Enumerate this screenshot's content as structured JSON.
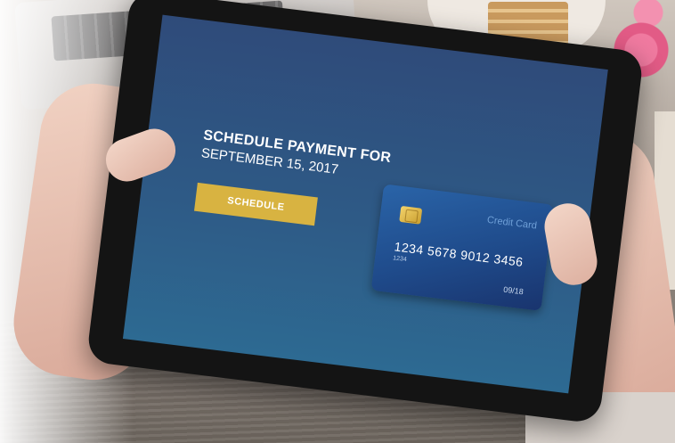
{
  "screen": {
    "headline_line1": "SCHEDULE PAYMENT FOR",
    "headline_line2": "SEPTEMBER 15, 2017",
    "schedule_button_label": "SCHEDULE"
  },
  "card": {
    "brand_label": "Credit Card",
    "number": "1234 5678 9012 3456",
    "small_number": "1234",
    "expiry": "09/18",
    "icon": "chip-icon"
  },
  "colors": {
    "screen_top": "#2f4b7a",
    "screen_bottom": "#2d6a92",
    "button": "#d8b341",
    "card": "#1f4b8b"
  }
}
